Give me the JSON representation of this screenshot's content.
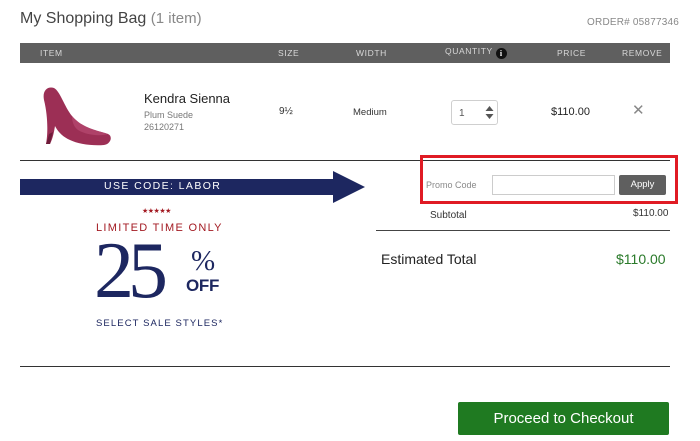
{
  "header": {
    "title": "My Shopping Bag",
    "count": "(1 item)",
    "order_label": "ORDER#",
    "order_number": "05877346"
  },
  "table": {
    "columns": {
      "item": "ITEM",
      "size": "SIZE",
      "width": "WIDTH",
      "quantity": "QUANTITY",
      "price": "PRICE",
      "remove": "REMOVE"
    },
    "info_icon_glyph": "i",
    "row": {
      "name": "Kendra Sienna",
      "color": "Plum Suede",
      "sku": "26120271",
      "size": "9½",
      "width": "Medium",
      "quantity": "1",
      "price": "$110.00",
      "remove_glyph": "✕",
      "image_icon": "pink-pump-shoe"
    }
  },
  "promo_banner": {
    "code_text": "USE CODE: LABOR",
    "stars": "★★★★★",
    "limited": "LIMITED TIME ONLY",
    "amount": "25",
    "percent": "%",
    "off": "OFF",
    "select": "SELECT SALE STYLES*",
    "colors": {
      "navy": "#1d2760",
      "red": "#a31a22"
    }
  },
  "promo": {
    "label": "Promo Code",
    "value": "",
    "apply_label": "Apply",
    "highlight_color": "#e01b24"
  },
  "summary": {
    "subtotal_label": "Subtotal",
    "subtotal_value": "$110.00",
    "total_label": "Estimated Total",
    "total_value": "$110.00"
  },
  "checkout": {
    "label": "Proceed to Checkout",
    "color": "#1f7a21"
  }
}
